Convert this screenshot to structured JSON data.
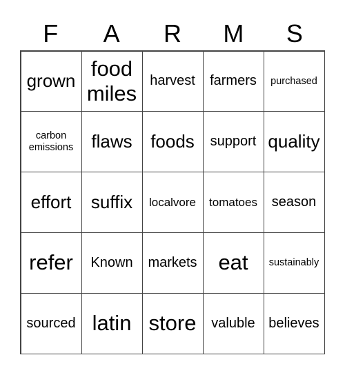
{
  "header": [
    "F",
    "A",
    "R",
    "M",
    "S"
  ],
  "cells": [
    [
      "grown",
      "food miles",
      "harvest",
      "farmers",
      "purchased"
    ],
    [
      "carbon emissions",
      "flaws",
      "foods",
      "support",
      "quality"
    ],
    [
      "effort",
      "suffix",
      "localvore",
      "tomatoes",
      "season"
    ],
    [
      "refer",
      "Known",
      "markets",
      "eat",
      "sustainably"
    ],
    [
      "sourced",
      "latin",
      "store",
      "valuble",
      "believes"
    ]
  ]
}
